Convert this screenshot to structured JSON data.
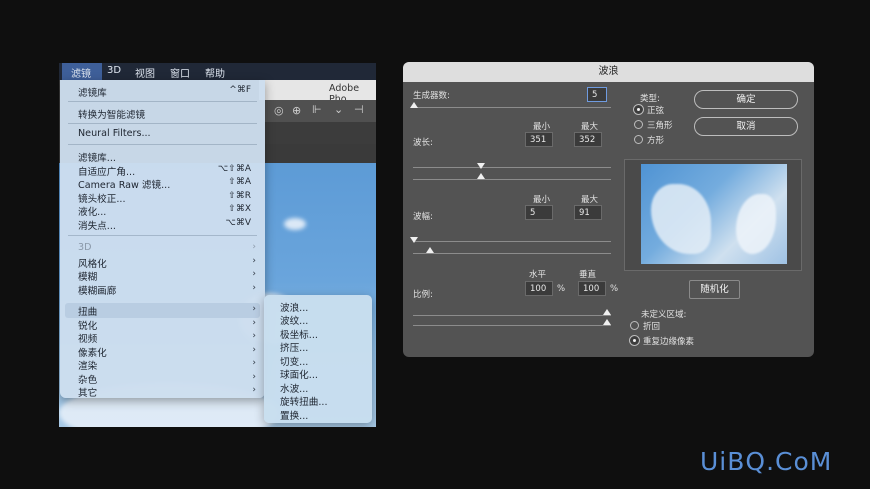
{
  "ps": {
    "menubar": [
      "滤镜",
      "3D",
      "视图",
      "窗口",
      "帮助"
    ],
    "title_fragment": "Adobe Pho"
  },
  "menu": {
    "items": [
      {
        "label": "滤镜库",
        "shortcut": "^⌘F"
      },
      {
        "label": "转换为智能滤镜"
      },
      {
        "label": "Neural Filters..."
      },
      {
        "label": "滤镜库..."
      },
      {
        "label": "自适应广角...",
        "shortcut": "⌥⇧⌘A"
      },
      {
        "label": "Camera Raw 滤镜...",
        "shortcut": "⇧⌘A"
      },
      {
        "label": "镜头校正...",
        "shortcut": "⇧⌘R"
      },
      {
        "label": "液化...",
        "shortcut": "⇧⌘X"
      },
      {
        "label": "消失点...",
        "shortcut": "⌥⌘V"
      },
      {
        "label": "3D",
        "disabled": true
      },
      {
        "label": "风格化"
      },
      {
        "label": "模糊"
      },
      {
        "label": "模糊画廊"
      },
      {
        "label": "扭曲",
        "highlighted": true
      },
      {
        "label": "锐化"
      },
      {
        "label": "视频"
      },
      {
        "label": "像素化"
      },
      {
        "label": "渲染"
      },
      {
        "label": "杂色"
      },
      {
        "label": "其它"
      }
    ],
    "arrow": "›"
  },
  "submenu": {
    "items": [
      "波浪...",
      "波纹...",
      "极坐标...",
      "挤压...",
      "切变...",
      "球面化...",
      "水波...",
      "旋转扭曲...",
      "置换..."
    ]
  },
  "dialog": {
    "title": "波浪",
    "generators_label": "生成器数:",
    "generators_value": "5",
    "wavelength_label": "波长:",
    "min_label": "最小",
    "max_label": "最大",
    "wavelength_min": "351",
    "wavelength_max": "352",
    "amplitude_label": "波幅:",
    "amplitude_min": "5",
    "amplitude_max": "91",
    "scale_label": "比例:",
    "horiz_label": "水平",
    "vert_label": "垂直",
    "scale_h": "100",
    "scale_v": "100",
    "percent": "%",
    "type_label": "类型:",
    "type_options": [
      "正弦",
      "三角形",
      "方形"
    ],
    "type_selected": "正弦",
    "ok": "确定",
    "cancel": "取消",
    "randomize": "随机化",
    "undefined_label": "未定义区域:",
    "undefined_options": [
      "折回",
      "重复边缘像素"
    ],
    "undefined_selected": "重复边缘像素"
  },
  "watermark": "UiBQ.CoM",
  "colors": {
    "accent": "#3e5f99",
    "dialog_bg": "#535353",
    "watermark": "#5a8fd6"
  }
}
